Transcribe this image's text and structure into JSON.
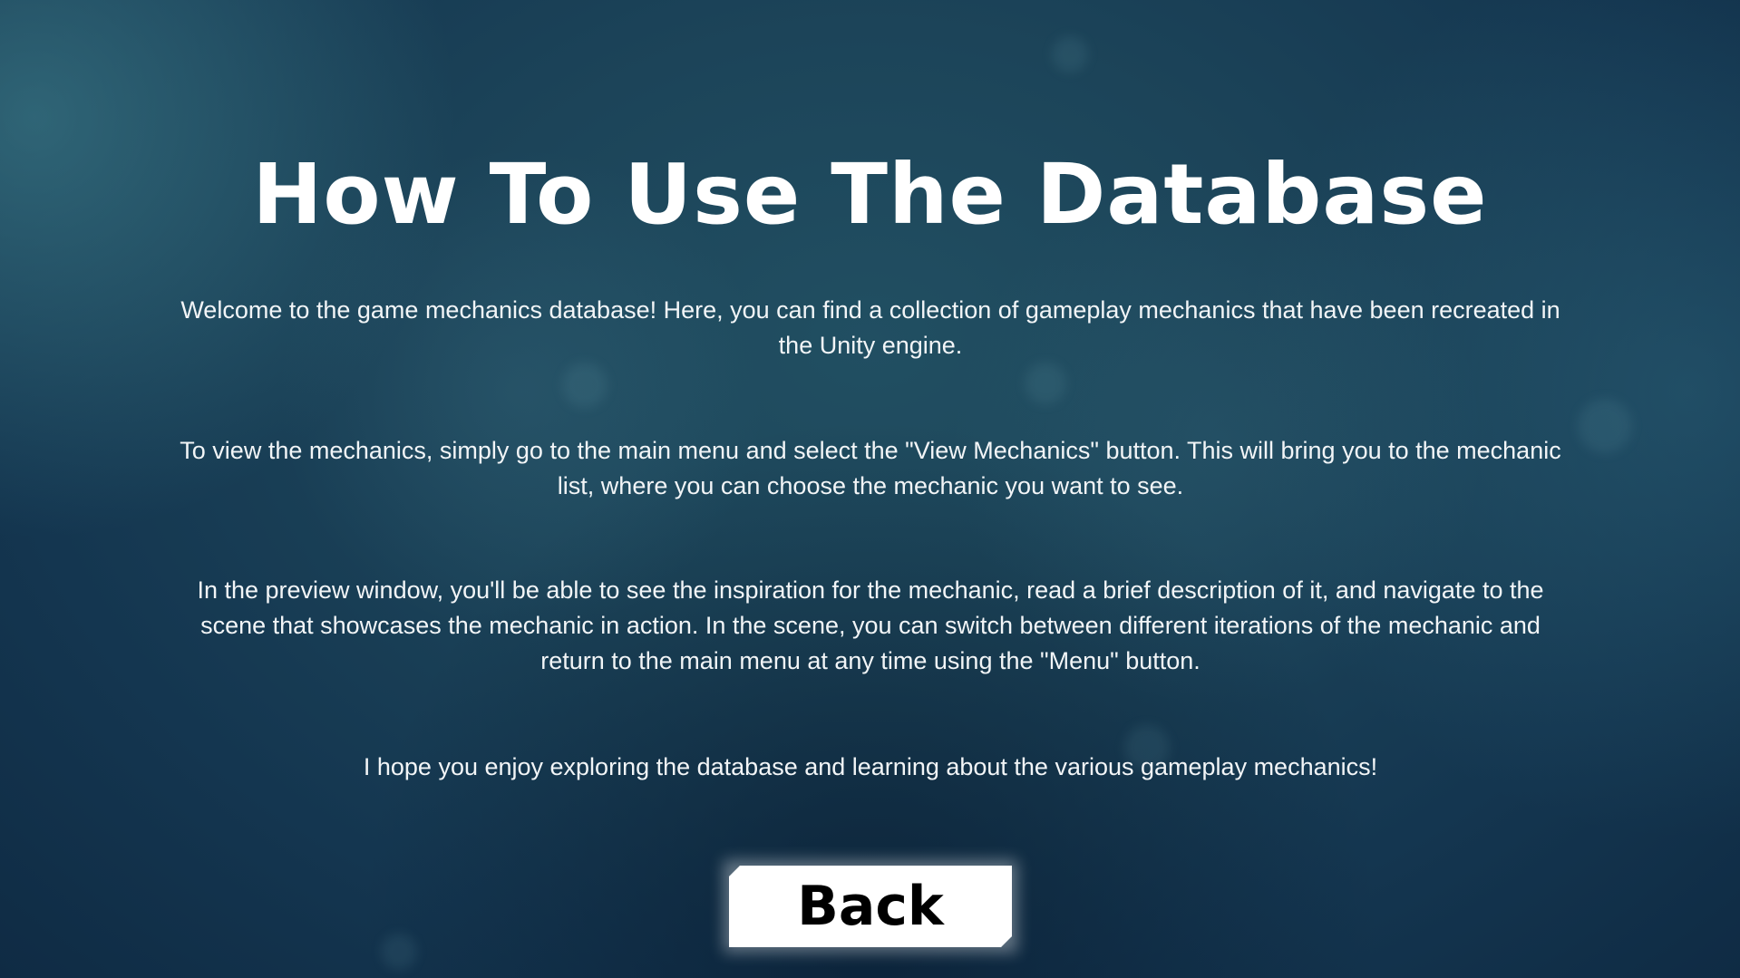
{
  "screen": {
    "title": "How To Use The Database",
    "paragraphs": [
      "Welcome to the game mechanics database! Here, you can find a collection of gameplay mechanics that have been recreated in the Unity engine.",
      "To view the mechanics, simply go to the main menu and select the \"View Mechanics\" button. This will bring you to the mechanic list, where you can choose the mechanic you want to see.",
      "In the preview window, you'll be able to see the inspiration for the mechanic, read a brief description of it, and navigate to the scene that showcases the mechanic in action. In the scene, you can switch between different iterations of the mechanic and return to the main menu at any time using the \"Menu\" button.",
      "I hope you enjoy exploring the database and learning about the various gameplay mechanics!"
    ],
    "back_label": "Back"
  },
  "colors": {
    "background": "#1c4459",
    "text": "#ffffff",
    "button_bg": "#ffffff",
    "button_text": "#000000"
  }
}
